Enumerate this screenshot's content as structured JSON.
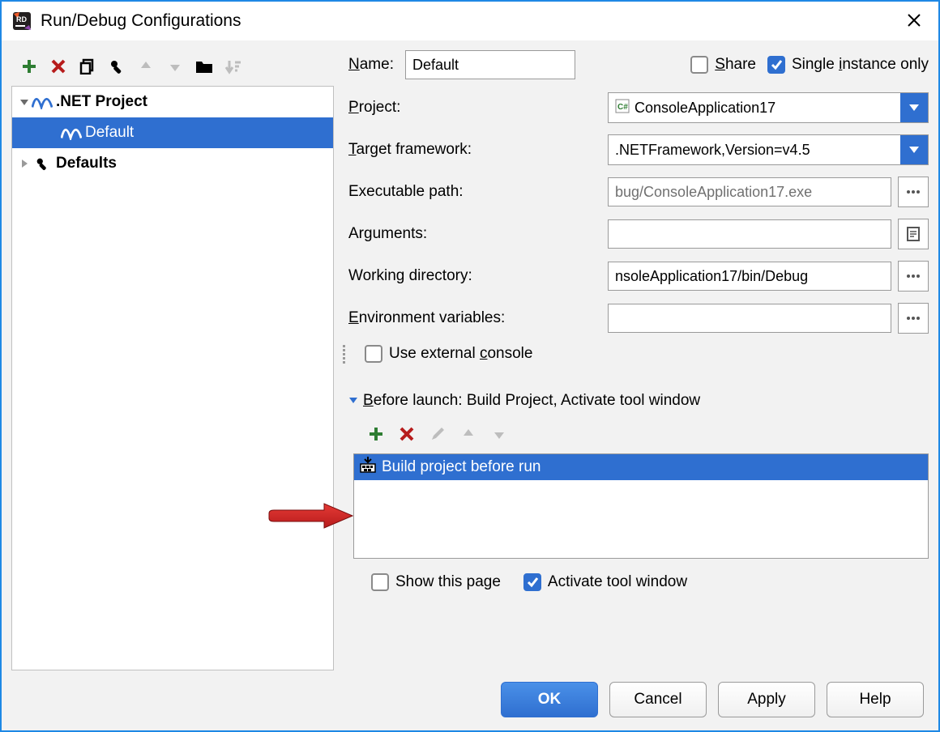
{
  "window": {
    "title": "Run/Debug Configurations"
  },
  "leftToolbar": {
    "add": "add-icon",
    "remove": "remove-icon",
    "copy": "copy-icon",
    "editDefaults": "wrench-icon",
    "up": "arrow-up-icon",
    "down": "arrow-down-icon",
    "folder": "folder-icon",
    "sort": "sort-icon"
  },
  "tree": {
    "root": {
      "label": ".NET Project"
    },
    "child": {
      "label": "Default"
    },
    "defaults": {
      "label": "Defaults"
    }
  },
  "form": {
    "nameLabelPrefix": "N",
    "nameLabelRest": "ame:",
    "nameValue": "Default",
    "shareLabelPrefix": "S",
    "shareLabelRest": "hare",
    "singleInstancePrefix": "Single ",
    "singleInstanceU": "i",
    "singleInstanceRest": "nstance only",
    "projectLabelPrefix": "P",
    "projectLabelRest": "roject:",
    "projectValue": "ConsoleApplication17",
    "targetFrameworkLabelPrefix": "T",
    "targetFrameworkLabelRest": "arget framework:",
    "targetFrameworkValue": ".NETFramework,Version=v4.5",
    "exePathLabel": "Executable path:",
    "exePathValue": "bug/ConsoleApplication17.exe",
    "argumentsLabel": "Arguments:",
    "argumentsValue": "",
    "workingDirLabel": "Working directory:",
    "workingDirValue": "nsoleApplication17/bin/Debug",
    "envVarsLabelPrefix": "E",
    "envVarsLabelRest": "nvironment variables:",
    "envVarsValue": "",
    "useExternalPrefix": "Use external ",
    "useExternalU": "c",
    "useExternalRest": "onsole"
  },
  "beforeLaunch": {
    "headerPrefix": "B",
    "headerRest": "efore launch: Build Project, Activate tool window",
    "item": "Build project before run"
  },
  "afterLaunch": {
    "showThisPage": "Show this page",
    "activateToolWindow": "Activate tool window"
  },
  "buttons": {
    "ok": "OK",
    "cancel": "Cancel",
    "apply": "Apply",
    "help": "Help"
  }
}
